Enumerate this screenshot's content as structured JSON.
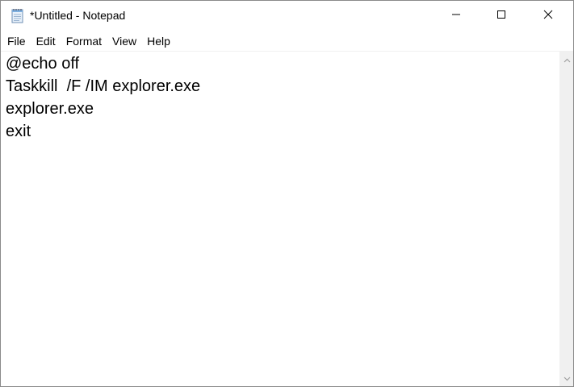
{
  "window": {
    "title": "*Untitled - Notepad",
    "app_icon": "notepad-icon",
    "controls": {
      "minimize_icon": "minimize-icon",
      "maximize_icon": "maximize-icon",
      "close_icon": "close-icon"
    }
  },
  "menu": {
    "items": [
      {
        "label": "File"
      },
      {
        "label": "Edit"
      },
      {
        "label": "Format"
      },
      {
        "label": "View"
      },
      {
        "label": "Help"
      }
    ]
  },
  "editor": {
    "lines": [
      "@echo off",
      "Taskkill  /F /IM explorer.exe",
      "explorer.exe",
      "exit"
    ]
  },
  "scrollbar": {
    "up_icon": "chevron-up-icon",
    "down_icon": "chevron-down-icon"
  },
  "colors": {
    "background": "#ffffff",
    "scrollbar_track": "#f0f0f0",
    "text": "#000000",
    "border": "#8a8a8a"
  }
}
